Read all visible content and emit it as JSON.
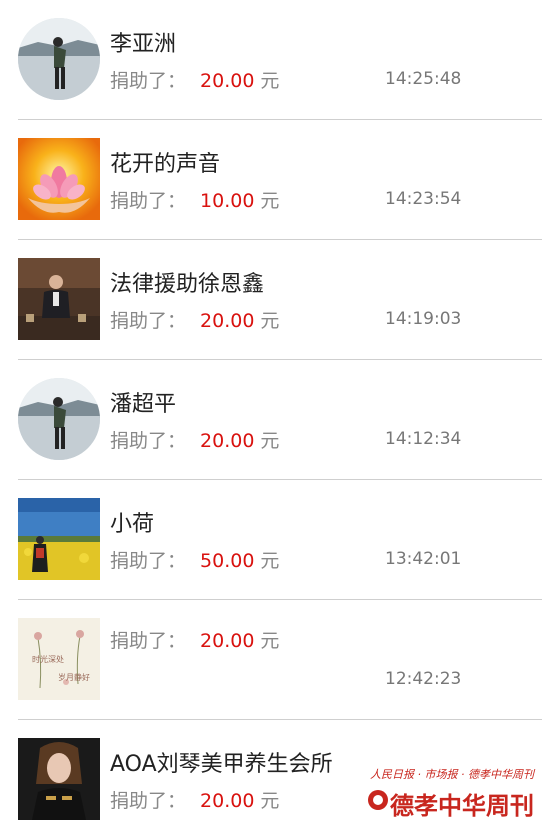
{
  "donations": [
    {
      "name": "李亚洲",
      "label": "捐助了：",
      "amount": "20.00",
      "unit": "元",
      "time": "14:25:48",
      "avatar": "man-lake-avatar"
    },
    {
      "name": "花开的声音",
      "label": "捐助了：",
      "amount": "10.00",
      "unit": "元",
      "time": "14:23:54",
      "avatar": "lotus-hands-avatar"
    },
    {
      "name": "法律援助徐恩鑫",
      "label": "捐助了：",
      "amount": "20.00",
      "unit": "元",
      "time": "14:19:03",
      "avatar": "man-office-avatar"
    },
    {
      "name": "潘超平",
      "label": "捐助了：",
      "amount": "20.00",
      "unit": "元",
      "time": "14:12:34",
      "avatar": "man-lake-avatar"
    },
    {
      "name": "小荷",
      "label": "捐助了：",
      "amount": "50.00",
      "unit": "元",
      "time": "13:42:01",
      "avatar": "woman-field-avatar"
    },
    {
      "name": "",
      "label": "捐助了：",
      "amount": "20.00",
      "unit": "元",
      "time": "12:42:23",
      "avatar": "flower-text-avatar",
      "avatar_text": [
        "时光深处",
        "岁月静好"
      ]
    },
    {
      "name": "AOA刘琴美甲养生会所",
      "label": "捐助了：",
      "amount": "20.00",
      "unit": "元",
      "time": "",
      "avatar": "woman-portrait-avatar"
    }
  ],
  "watermark": {
    "top_line": "人民日报 · 市场报 · 德孝中华周刊",
    "main": "德孝中华周刊"
  },
  "colors": {
    "amount": "#d9120f",
    "label": "#888888",
    "name": "#222222",
    "separator": "#cfcfcf",
    "brand": "#c8261e"
  }
}
